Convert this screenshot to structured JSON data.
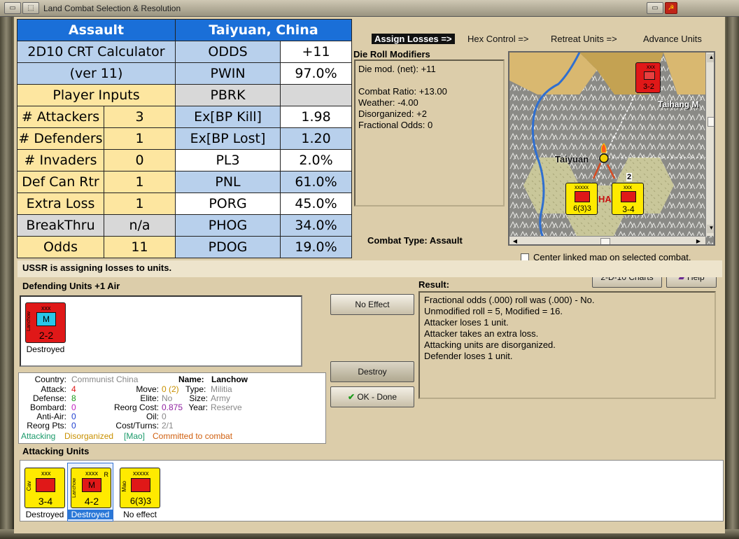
{
  "window": {
    "title": "Land Combat Selection & Resolution"
  },
  "crt": {
    "title_left": "Assault",
    "title_right": "Taiyuan, China",
    "calc_line1": "2D10 CRT Calculator",
    "calc_line2": "(ver 11)",
    "player_inputs": "Player Inputs",
    "rows_left": [
      [
        "# Attackers",
        "3"
      ],
      [
        "# Defenders",
        "1"
      ],
      [
        "# Invaders",
        "0"
      ],
      [
        "Def Can Rtr",
        "1"
      ],
      [
        "Extra Loss",
        "1"
      ],
      [
        "BreakThru",
        "n/a"
      ],
      [
        "Odds",
        "11"
      ]
    ],
    "rows_right": [
      [
        "ODDS",
        "+11"
      ],
      [
        "PWIN",
        "97.0%"
      ],
      [
        "PBRK",
        ""
      ],
      [
        "Ex[BP Kill]",
        "1.98"
      ],
      [
        "Ex[BP Lost]",
        "1.20"
      ],
      [
        "PL3",
        "2.0%"
      ],
      [
        "PNL",
        "61.0%"
      ],
      [
        "PORG",
        "45.0%"
      ],
      [
        "PHOG",
        "34.0%"
      ],
      [
        "PDOG",
        "19.0%"
      ]
    ]
  },
  "tabs": [
    "Assign Losses =>",
    "Hex Control =>",
    "Retreat Units =>",
    "Advance Units"
  ],
  "drm": {
    "title": "Die Roll Modifiers",
    "lines": [
      "Die mod. (net): +11",
      "",
      "Combat Ratio: +13.00",
      "Weather: -4.00",
      "Disorganized: +2",
      "Fractional Odds: 0"
    ]
  },
  "map": {
    "city": "Taiyuan",
    "mountain": "Taihang M",
    "overlay": "HA",
    "unit_top": {
      "size": "xxx",
      "value": "3-2"
    },
    "unit_a": {
      "size": "xxxxx",
      "value": "6(3)3"
    },
    "unit_b": {
      "size": "xxx",
      "value": "3-4"
    },
    "stack": "2"
  },
  "combat_type": "Combat Type:  Assault",
  "center_map": "Center linked map on selected combat.",
  "buttons": {
    "charts": "2-D-10 Charts",
    "help": "Help",
    "no_effect": "No Effect",
    "destroy": "Destroy",
    "ok": "OK - Done"
  },
  "message": "USSR is assigning losses to units.",
  "defending": {
    "label": "Defending Units +1 Air",
    "unit": {
      "size": "xxx",
      "type": "M",
      "side": "Lanchow",
      "value": "2-2",
      "status": "Destroyed"
    }
  },
  "result": {
    "label": "Result:",
    "lines": [
      "Fractional odds (.000) roll was (.000)  - No.",
      "Unmodified roll = 5, Modified = 16.",
      "Attacker loses 1 unit.",
      "Attacker takes an extra loss.",
      "Attacking units are disorganized.",
      "Defender loses 1 unit."
    ]
  },
  "info": {
    "country_k": "Country:",
    "country_v": "Communist China",
    "name_k": "Name:",
    "name_v": "Lanchow",
    "attack_k": "Attack:",
    "attack_v": "4",
    "move_k": "Move:",
    "move_v": "0 (2)",
    "type_k": "Type:",
    "type_v": "Militia",
    "defense_k": "Defense:",
    "defense_v": "8",
    "elite_k": "Elite:",
    "elite_v": "No",
    "size_k": "Size:",
    "size_v": "Army",
    "bombard_k": "Bombard:",
    "bombard_v": "0",
    "reorg_k": "Reorg Cost:",
    "reorg_v": "0.875",
    "year_k": "Year:",
    "year_v": "Reserve",
    "aa_k": "Anti-Air:",
    "aa_v": "0",
    "oil_k": "Oil:",
    "oil_v": "0",
    "rpts_k": "Reorg Pts:",
    "rpts_v": "0",
    "cost_k": "Cost/Turns:",
    "cost_v": "2/1",
    "s1": "Attacking",
    "s2": "Disorganized",
    "s3": "[Mao]",
    "s4": "Committed to combat"
  },
  "attacking": {
    "label": "Attacking Units",
    "units": [
      {
        "size": "xxx",
        "side": "Cav",
        "value": "3-4",
        "status": "Destroyed"
      },
      {
        "size": "xxxx",
        "side": "Lanchow",
        "type": "M",
        "value": "4-2",
        "status": "Destroyed",
        "flag": "R"
      },
      {
        "size": "xxxxx",
        "side": "Mao",
        "value": "6(3)3",
        "status": "No effect"
      }
    ]
  },
  "colors": {
    "header": "#1a6fd8",
    "soviet_yellow": "#ffea00",
    "chinese_red": "#e01818"
  }
}
